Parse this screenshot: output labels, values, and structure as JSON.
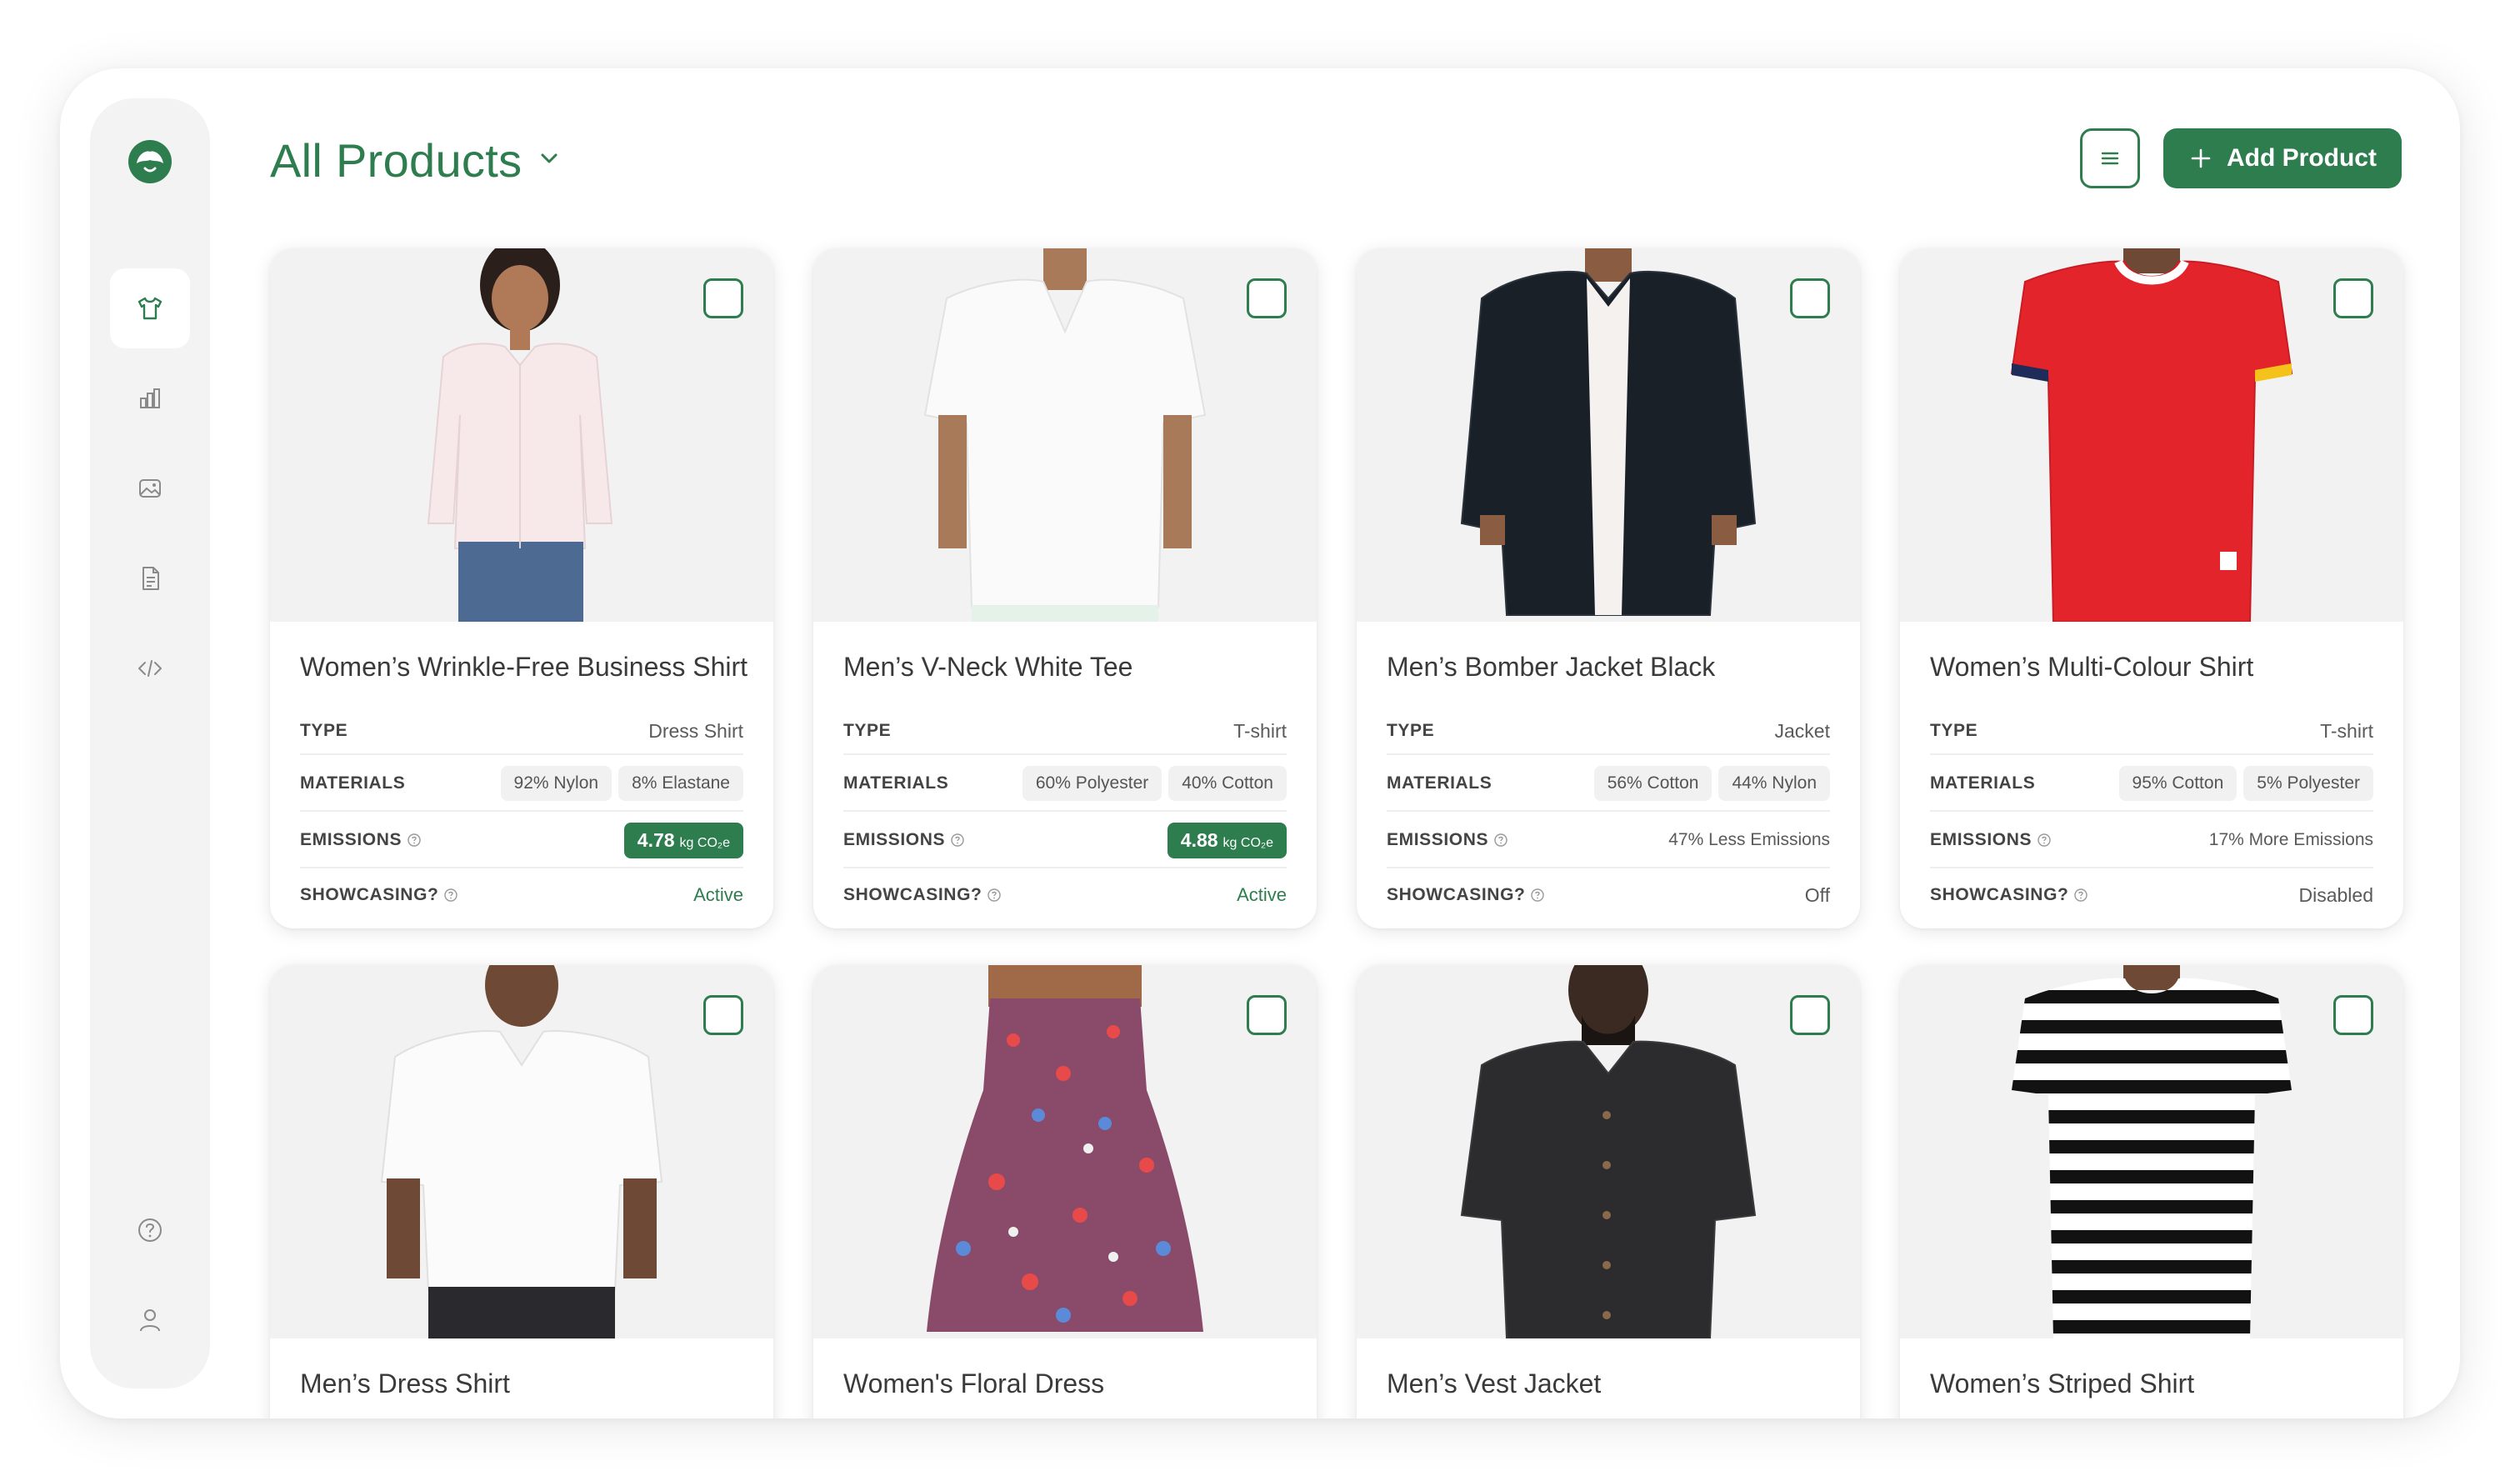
{
  "header": {
    "title": "All Products",
    "add_label": "Add Product"
  },
  "sidebar": {
    "items": [
      {
        "icon": "tshirt-icon",
        "active": true
      },
      {
        "icon": "bar-chart-icon",
        "active": false
      },
      {
        "icon": "image-icon",
        "active": false
      },
      {
        "icon": "document-icon",
        "active": false
      },
      {
        "icon": "code-icon",
        "active": false
      },
      {
        "icon": "help-icon",
        "active": false
      },
      {
        "icon": "user-icon",
        "active": false
      }
    ]
  },
  "labels": {
    "type": "TYPE",
    "materials": "MATERIALS",
    "emissions": "EMISSIONS",
    "showcasing": "SHOWCASING?"
  },
  "products": [
    {
      "name": "Women’s Wrinkle-Free Business Shirt",
      "type": "Dress Shirt",
      "materials": [
        "92% Nylon",
        "8% Elastane"
      ],
      "emissions_value": "4.78",
      "emissions_unit": "kg CO₂e",
      "showcasing": "Active"
    },
    {
      "name": "Men’s V-Neck White Tee",
      "type": "T-shirt",
      "materials": [
        "60% Polyester",
        "40% Cotton"
      ],
      "emissions_value": "4.88",
      "emissions_unit": "kg CO₂e",
      "showcasing": "Active"
    },
    {
      "name": "Men’s Bomber Jacket Black",
      "type": "Jacket",
      "materials": [
        "56% Cotton",
        "44% Nylon"
      ],
      "emissions_text": "47% Less Emissions",
      "showcasing": "Off"
    },
    {
      "name": "Women’s Multi-Colour Shirt",
      "type": "T-shirt",
      "materials": [
        "95% Cotton",
        "5% Polyester"
      ],
      "emissions_text": "17% More Emissions",
      "showcasing": "Disabled"
    },
    {
      "name": "Men’s Dress Shirt"
    },
    {
      "name": "Women's Floral Dress"
    },
    {
      "name": "Men’s Vest Jacket"
    },
    {
      "name": "Women’s Striped Shirt"
    }
  ],
  "colors": {
    "brand": "#2e7d4f",
    "card_image_bg": "#f2f2f2"
  }
}
